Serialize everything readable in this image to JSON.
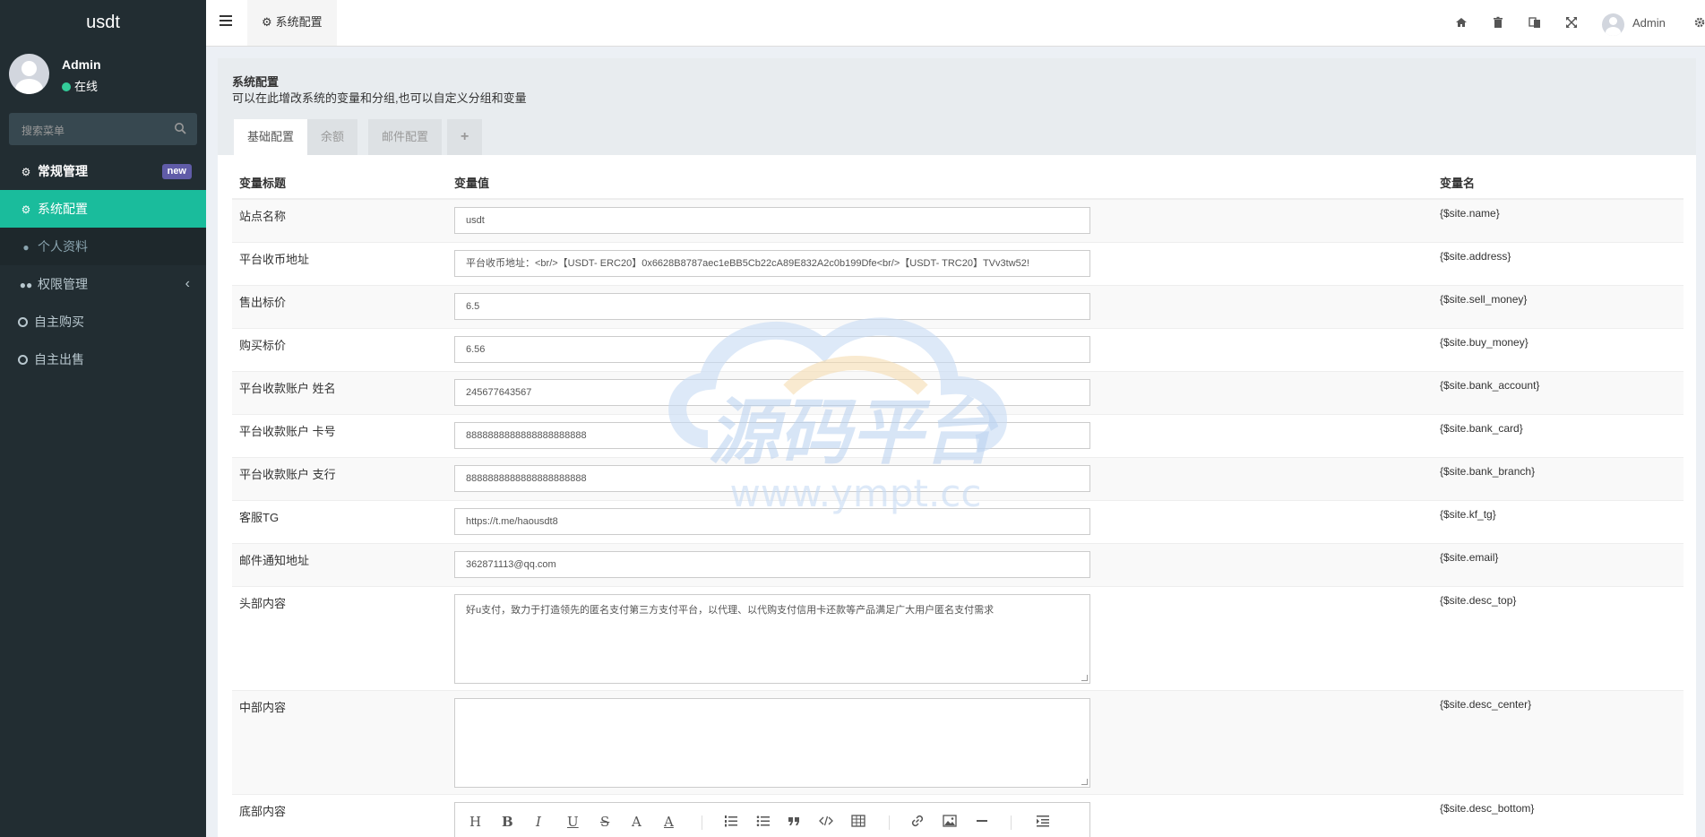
{
  "sidebar": {
    "logo": "usdt",
    "user": {
      "name": "Admin",
      "status": "在线"
    },
    "search_placeholder": "搜索菜单",
    "items": [
      {
        "label": "常规管理",
        "badge": "new"
      },
      {
        "label": "系统配置"
      },
      {
        "label": "个人资料"
      },
      {
        "label": "权限管理"
      },
      {
        "label": "自主购买"
      },
      {
        "label": "自主出售"
      }
    ]
  },
  "topbar": {
    "tab": "系统配置",
    "user": "Admin"
  },
  "panel": {
    "title": "系统配置",
    "description": "可以在此增改系统的变量和分组,也可以自定义分组和变量",
    "tabs": [
      "基础配置",
      "余额",
      "邮件配置",
      "+"
    ]
  },
  "table": {
    "headers": [
      "变量标题",
      "变量值",
      "变量名"
    ],
    "rows": [
      {
        "label": "站点名称",
        "value": "usdt",
        "var": "{$site.name}"
      },
      {
        "label": "平台收币地址",
        "value": "平台收币地址：<br/>【USDT- ERC20】0x6628B8787aec1eBB5Cb22cA89E832A2c0b199Dfe<br/>【USDT- TRC20】TVv3tw52!",
        "var": "{$site.address}"
      },
      {
        "label": "售出标价",
        "value": "6.5",
        "var": "{$site.sell_money}"
      },
      {
        "label": "购买标价",
        "value": "6.56",
        "var": "{$site.buy_money}"
      },
      {
        "label": "平台收款账户 姓名",
        "value": "245677643567",
        "var": "{$site.bank_account}"
      },
      {
        "label": "平台收款账户 卡号",
        "value": "8888888888888888888888",
        "var": "{$site.bank_card}"
      },
      {
        "label": "平台收款账户 支行",
        "value": "8888888888888888888888",
        "var": "{$site.bank_branch}"
      },
      {
        "label": "客服TG",
        "value": "https://t.me/haousdt8",
        "var": "{$site.kf_tg}"
      },
      {
        "label": "邮件通知地址",
        "value": "362871113@qq.com",
        "var": "{$site.email}"
      },
      {
        "label": "头部内容",
        "value": "好u支付，致力于打造领先的匿名支付第三方支付平台，以代理、以代购支付信用卡还款等产品满足广大用户匿名支付需求",
        "var": "{$site.desc_top}"
      },
      {
        "label": "中部内容",
        "value": "",
        "var": "{$site.desc_center}"
      },
      {
        "label": "底部内容",
        "value": "",
        "var": "{$site.desc_bottom}"
      }
    ]
  },
  "editor_toolbar": [
    "H",
    "B",
    "I",
    "U",
    "S",
    "A",
    "A"
  ],
  "watermark": {
    "title": "源码平台",
    "url": "www.ympt.cc"
  }
}
